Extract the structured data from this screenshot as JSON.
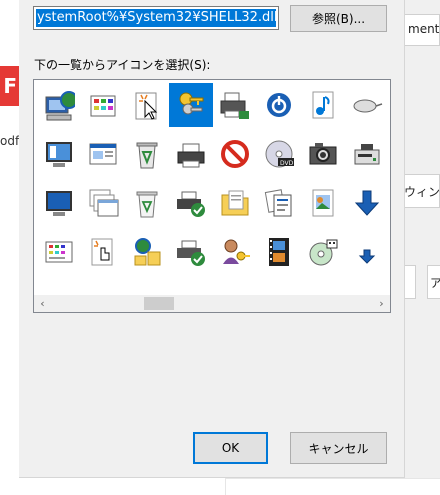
{
  "background": {
    "pdf_badge": "F",
    "pdf_text": "odf",
    "right_texts": [
      "ments",
      "ウィン",
      "ア"
    ]
  },
  "dialog": {
    "path_value": "ystemRoot%¥System32¥SHELL32.dll",
    "browse_label": "参照(B)...",
    "list_label": "下の一覧からアイコンを選択(S):",
    "icons": [
      "network-computer-icon",
      "control-panel-icon",
      "cursor-click-icon",
      "keys-icon",
      "printer-network-icon",
      "power-icon",
      "music-note-icon",
      "mouse-icon",
      "monitor-settings-icon",
      "window-icon",
      "recycle-bin-full-icon",
      "printer-icon",
      "prohibited-icon",
      "dvd-disc-icon",
      "camera-icon",
      "drive-icon",
      "monitor-icon",
      "windows-stack-icon",
      "recycle-bin-icon",
      "printer-default-icon",
      "folder-document-icon",
      "documents-icon",
      "image-frame-icon",
      "download-arrow-icon",
      "icon-list-icon",
      "hand-pointer-icon",
      "network-users-icon",
      "fax-default-icon",
      "user-key-icon",
      "filmstrip-icon",
      "cd-audio-icon",
      "download-small-icon"
    ],
    "selected_index": 3,
    "scroll_left": "‹",
    "scroll_right": "›",
    "ok_label": "OK",
    "cancel_label": "キャンセル"
  }
}
